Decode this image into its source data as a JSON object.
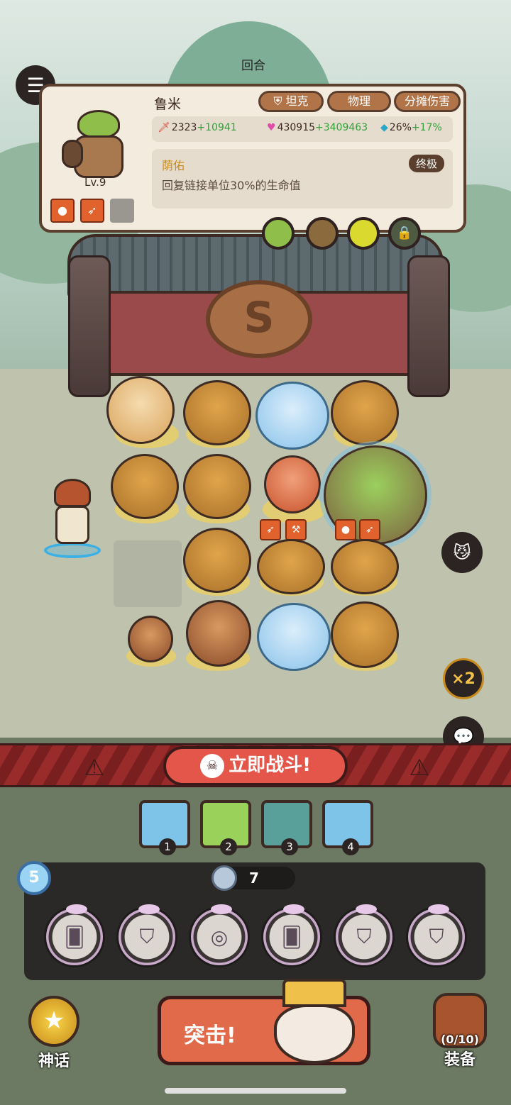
{
  "header": {
    "round_label": "回合"
  },
  "unit_info": {
    "name": "鲁米",
    "level": "Lv.9",
    "tags": [
      "坦克",
      "物理",
      "分摊伤害"
    ],
    "attack": {
      "base": "2323",
      "bonus": "+10941"
    },
    "hp": {
      "base": "430915",
      "bonus": "+3409463"
    },
    "crit": {
      "base": "26%",
      "bonus": "+17%"
    },
    "skill": {
      "name": "荫佑",
      "badge": "终极",
      "description": "回复链接单位30%的生命值"
    },
    "equipment_icons": [
      "apple-icon",
      "bow-icon",
      "empty-slot"
    ],
    "skill_orbs": [
      "leaf-orb",
      "log-orb",
      "lemon-orb",
      "lock-icon"
    ]
  },
  "battle": {
    "speed_label": "×2",
    "fight_button_label": "立即战斗!"
  },
  "queue": {
    "numbers": [
      "1",
      "2",
      "3",
      "4"
    ]
  },
  "shop": {
    "level": "5",
    "coins": "7",
    "slots": [
      "card",
      "armor",
      "coins",
      "card",
      "armor",
      "armor"
    ]
  },
  "bottom": {
    "myth_label": "神话",
    "assault_label": "突击!",
    "equip_count": "(0/10)",
    "equip_label": "装备"
  },
  "colors": {
    "banner_red": "#9a2b2b",
    "bonus_green": "#2fa23a",
    "panel_cream": "#f3ebde",
    "skill_gold": "#c88a1a"
  }
}
